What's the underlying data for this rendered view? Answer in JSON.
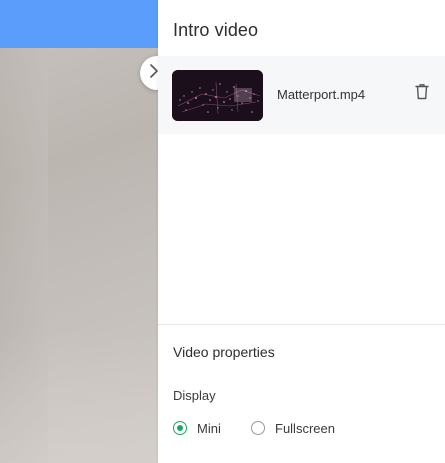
{
  "viewer": {
    "accent_color": "#5b9dfa"
  },
  "toggle": {
    "icon": "chevron-right-icon"
  },
  "panel": {
    "title": "Intro video",
    "video": {
      "file_name": "Matterport.mp4",
      "delete_icon": "trash-icon"
    },
    "properties": {
      "title": "Video properties",
      "display_label": "Display",
      "options": [
        {
          "label": "Mini",
          "selected": true
        },
        {
          "label": "Fullscreen",
          "selected": false
        }
      ],
      "selected_color": "#1aa865"
    }
  }
}
